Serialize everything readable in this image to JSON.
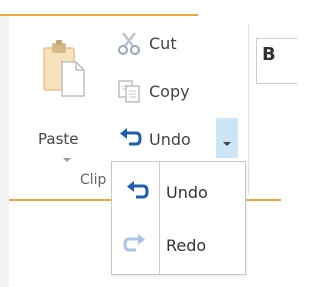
{
  "clipboard": {
    "paste_label": "Paste",
    "cut_label": "Cut",
    "copy_label": "Copy",
    "undo_label": "Undo",
    "group_label": "Clip"
  },
  "undo_menu": {
    "items": [
      {
        "label": "Undo",
        "icon": "undo-icon",
        "enabled": true
      },
      {
        "label": "Redo",
        "icon": "redo-icon",
        "enabled": false
      }
    ]
  },
  "next_group": {
    "partial_label": "B"
  },
  "colors": {
    "accent_orange": "#f0a83a",
    "undo_blue": "#1f5fae",
    "redo_disabled": "#a9c4e6",
    "dropdown_highlight": "#cde6f7"
  }
}
